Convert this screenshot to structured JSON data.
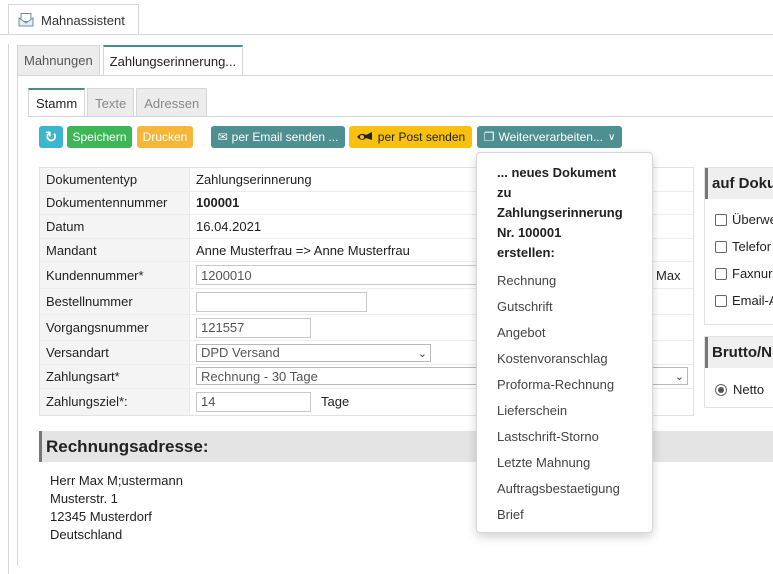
{
  "window": {
    "tab_title": "Mahnassistent",
    "icon": "envelope-document-icon"
  },
  "tabs1": [
    "Mahnungen",
    "Zahlungserinnerung..."
  ],
  "tabs2": [
    "Stamm",
    "Texte",
    "Adressen"
  ],
  "toolbar": {
    "refresh_icon": "refresh-icon",
    "save": "Speichern",
    "print": "Drucken",
    "email": "per Email senden ...",
    "post": "per Post senden",
    "further": "Weiterverarbeiten...",
    "colors": {
      "refresh": "#3cb6cf",
      "save": "#3eb655",
      "print": "#f4b73a",
      "email": "#4e8f92",
      "post": "#f9c10f"
    }
  },
  "form": {
    "doctype_label": "Dokumententyp",
    "doctype": "Zahlungserinnerung",
    "docnum_label": "Dokumentennummer",
    "docnum": "100001",
    "date_label": "Datum",
    "date": "16.04.2021",
    "mandant_label": "Mandant",
    "mandant": "Anne Musterfrau => Anne Musterfrau",
    "customer_label": "Kundennummer*",
    "customer": "1200010",
    "customer_suffix": "Max",
    "order_label": "Bestellnummer",
    "order": "",
    "process_label": "Vorgangsnummer",
    "process": "121557",
    "shipping_label": "Versandart",
    "shipping": "DPD Versand",
    "payment_label": "Zahlungsart*",
    "payment": "Rechnung - 30 Tage",
    "term_label": "Zahlungsziel*:",
    "term": "14",
    "term_unit": "Tage"
  },
  "address": {
    "heading": "Rechnungsadresse:",
    "lines": [
      "Herr Max M;ustermann",
      "Musterstr. 1",
      "12345 Musterdorf",
      "Deutschland"
    ]
  },
  "right": {
    "panel1_title": "auf Doku",
    "options": [
      "Überwe",
      "Telefor",
      "Faxnur",
      "Email-A"
    ],
    "panel2_title": "Brutto/N",
    "netto": "Netto"
  },
  "dropdown": {
    "header": [
      "... neues Dokument",
      "zu",
      "Zahlungserinnerung",
      "Nr. 100001",
      "erstellen:"
    ],
    "items": [
      "Rechnung",
      "Gutschrift",
      "Angebot",
      "Kostenvoranschlag",
      "Proforma-Rechnung",
      "Lieferschein",
      "Lastschrift-Storno",
      "Letzte Mahnung",
      "Auftragsbestaetigung",
      "Brief"
    ]
  }
}
